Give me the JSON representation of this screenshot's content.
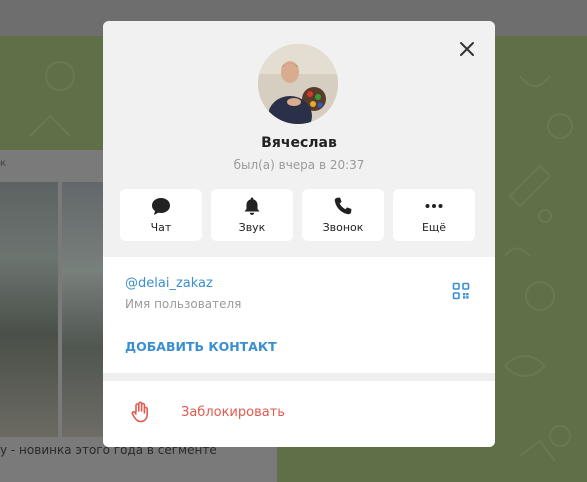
{
  "background": {
    "caption": "у - новинка этого года в сегменте",
    "mark": "к"
  },
  "profile": {
    "name": "Вячеслав",
    "status": "был(а) вчера в 20:37"
  },
  "actions": [
    {
      "label": "Чат",
      "icon": "chat-icon"
    },
    {
      "label": "Звук",
      "icon": "bell-icon"
    },
    {
      "label": "Звонок",
      "icon": "phone-icon"
    },
    {
      "label": "Ещё",
      "icon": "more-icon"
    }
  ],
  "info": {
    "username": "@delai_zakaz",
    "username_label": "Имя пользователя",
    "add_contact": "ДОБАВИТЬ КОНТАКТ"
  },
  "block": {
    "label": "Заблокировать"
  },
  "colors": {
    "accent": "#3a8fd0",
    "danger": "#e05a4f"
  }
}
